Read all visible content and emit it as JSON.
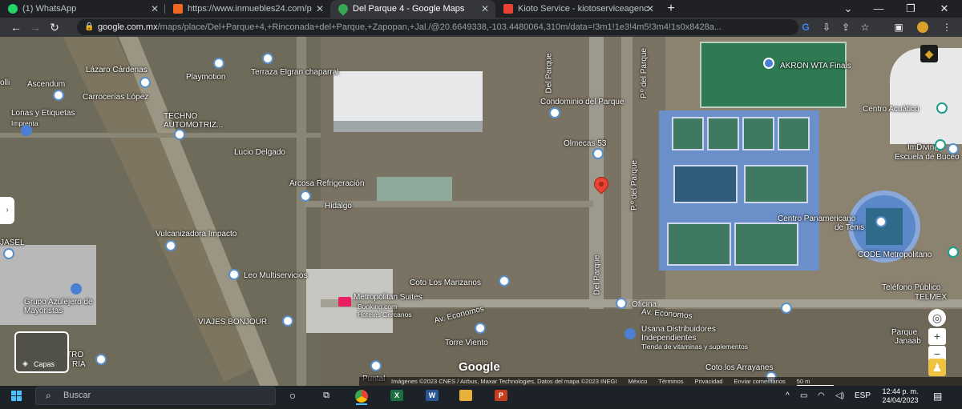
{
  "tabs": [
    {
      "title": "(1) WhatsApp",
      "icon": "whatsapp-icon",
      "color": "#25d366"
    },
    {
      "title": "https://www.inmuebles24.com/p",
      "icon": "inmuebles24-icon",
      "color": "#f26722"
    },
    {
      "title": "Del Parque 4 - Google Maps",
      "icon": "google-maps-icon",
      "color": "#34a853"
    },
    {
      "title": "Kioto Service - kiotoserviceagenc",
      "icon": "gmail-icon",
      "color": "#ea4335"
    }
  ],
  "new_tab_label": "+",
  "address": {
    "host": "google.com.mx",
    "path": "/maps/place/Del+Parque+4,+Rinconada+del+Parque,+Zapopan,+Jal./@20.6649338,-103.4480064,310m/data=!3m1!1e3!4m5!3m4!1s0x8428a..."
  },
  "map_labels": {
    "lazaro": "Lázaro Cárdenas",
    "ascendum": "Ascendum",
    "playmotion": "Playmotion",
    "terraza": "Terraza Elgran chaparral",
    "carrocerias": "Carrocerías López",
    "lonas": "Lonas y Etiquetas",
    "imprenta": "Imprenta",
    "techno": "TECHNO AUTOMOTRIZ...",
    "lucio": "Lucio Delgado",
    "arcosa": "Arcosa Refrigeración",
    "hidalgo": "Hidalgo",
    "vulcanizadora": "Vulcanizadora Impacto",
    "leo": "Leo Multiservicios",
    "grupo": "Grupo Azulejero de Mayoristas",
    "metropolitan": "Metropolitan Suites",
    "booking": "Booking.com",
    "hoteles": "Hoteles Cercanos",
    "viajes": "VIAJES BONJOUR",
    "coto_manzanos": "Coto Los Manzanos",
    "av_economos_1": "Av. Economos",
    "torre": "Torre Viento",
    "condominio": "Condominio del Parque",
    "olmecas": "Olmecas 53",
    "del_parque_v1": "Del Parque",
    "del_parque_v2": "P.º del Parque",
    "del_parque_v3": "P.º del Parque",
    "del_parque_v4": "Del Parque",
    "akron": "AKRON WTA Finals",
    "centro_acuatico": "Centro Acuático",
    "imdiving": "ImDiving",
    "escuela": "Escuela de Buceo",
    "centro_panam": "Centro Panamericano",
    "tenis": "de Tenis",
    "code": "CODE Metropolitano",
    "telefono": "Teléfono Público",
    "telmex": "TELMEX",
    "oficina": "Oficina",
    "av_economos_2": "Av. Economos",
    "usana": "Usana Distribuidores",
    "independientes": "Independientes",
    "tienda": "Tienda de vitaminas y suplementos",
    "coto_arrayanes": "Coto los Arrayanes",
    "parque": "Parque",
    "janaab": "Janaab",
    "jasel": "JASEL",
    "olli": "olli",
    "tro": "TRO",
    "ria": "RIA",
    "puntal": "Puntal"
  },
  "layers_label": "Capas",
  "google_logo": "Google",
  "attribution": {
    "imagery": "Imágenes ©2023 CNES / Airbus, Maxar Technologies, Datos del mapa ©2023 INEGI",
    "mexico": "México",
    "terms": "Términos",
    "privacy": "Privacidad",
    "feedback": "Enviar comentarios",
    "scale": "50 m"
  },
  "taskbar": {
    "search_placeholder": "Buscar",
    "lang": "ESP",
    "time": "12:44 p. m.",
    "date": "24/04/2023"
  },
  "colors": {
    "accent": "#4cc2ff",
    "pin_red": "#ea4335"
  }
}
